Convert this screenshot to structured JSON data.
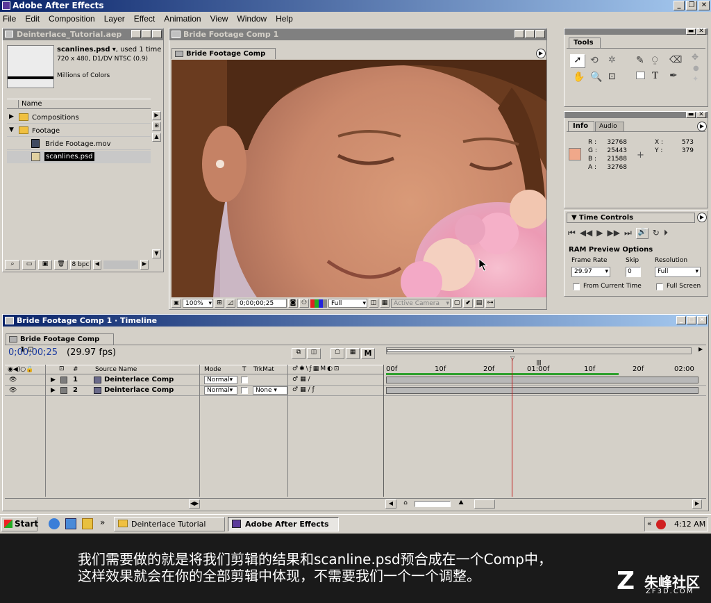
{
  "app": {
    "title": "Adobe After Effects"
  },
  "menu": [
    "File",
    "Edit",
    "Composition",
    "Layer",
    "Effect",
    "Animation",
    "View",
    "Window",
    "Help"
  ],
  "project": {
    "title": "Deinterlace_Tutorial.aep",
    "selected_name": "scanlines.psd",
    "selected_used": ", used 1 time",
    "selected_info": "720 x 480, D1/DV NTSC (0.9)",
    "selected_colors": "Millions of Colors",
    "col_name": "Name",
    "items": [
      {
        "label": "Compositions",
        "type": "folder",
        "expanded": false
      },
      {
        "label": "Footage",
        "type": "folder",
        "expanded": true
      },
      {
        "label": "Bride Footage.mov",
        "type": "footage"
      },
      {
        "label": "scanlines.psd",
        "type": "image",
        "selected": true
      }
    ],
    "bpc": "8 bpc"
  },
  "comp": {
    "title": "Bride Footage Comp 1",
    "tab": "Bride Footage Comp 1",
    "zoom": "100%",
    "timecode": "0;00;00;25",
    "resolution": "Full",
    "camera": "Active Camera"
  },
  "tools": {
    "title": "Tools"
  },
  "info": {
    "tab_info": "Info",
    "tab_audio": "Audio",
    "r_label": "R :",
    "r": "32768",
    "g_label": "G :",
    "g": "25443",
    "b_label": "B :",
    "b": "21588",
    "a_label": "A :",
    "a": "32768",
    "x_label": "X :",
    "x": "573",
    "y_label": "Y :",
    "y": "379",
    "swatch": "#f0a88a"
  },
  "time_controls": {
    "title": "Time Controls",
    "ram_preview": "RAM Preview Options",
    "frame_rate_label": "Frame Rate",
    "frame_rate": "29.97",
    "skip_label": "Skip",
    "skip": "0",
    "resolution_label": "Resolution",
    "resolution": "Full",
    "from_current": "From Current Time",
    "full_screen": "Full Screen"
  },
  "timeline": {
    "title": "Bride Footage Comp 1 · Timeline",
    "tab": "Bride Footage Comp 1",
    "timecode": "0;00;00;25",
    "fps": "(29.97 fps)",
    "col_num": "#",
    "col_source": "Source Name",
    "col_mode": "Mode",
    "col_t": "T",
    "col_trkmat": "TrkMat",
    "ruler": [
      "00f",
      "10f",
      "20f",
      "01:00f",
      "10f",
      "20f",
      "02:00"
    ],
    "layers": [
      {
        "num": "1",
        "name": "Deinterlace Comp",
        "mode": "Normal",
        "trkmat": ""
      },
      {
        "num": "2",
        "name": "Deinterlace Comp",
        "mode": "Normal",
        "trkmat": "None"
      }
    ]
  },
  "taskbar": {
    "start": "Start",
    "task1": "Deinterlace Tutorial",
    "task2": "Adobe After Effects",
    "time": "4:12 AM"
  },
  "subtitle": {
    "line1": "我们需要做的就是将我们剪辑的结果和scanline.psd预合成在一个Comp中，",
    "line2": "这样效果就会在你的全部剪辑中体现，不需要我们一个一个调整。"
  },
  "watermark": {
    "text": "朱峰社区",
    "sub": "ZF3D.COM"
  }
}
